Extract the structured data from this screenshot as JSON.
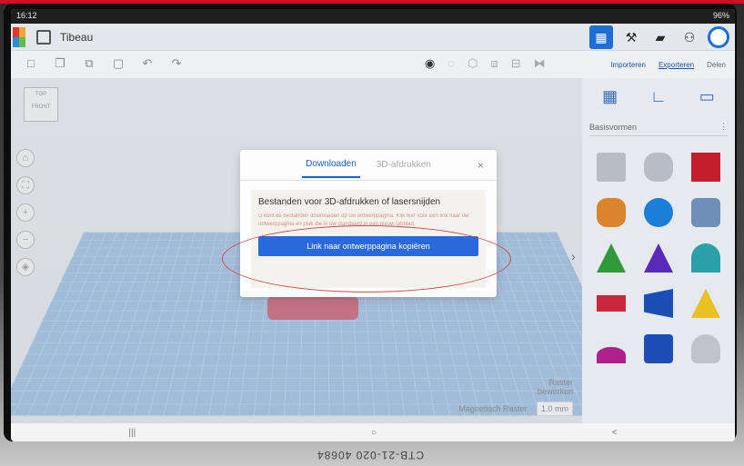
{
  "status": {
    "time": "16:12",
    "battery": "96%"
  },
  "app": {
    "title": "Tibeau"
  },
  "tabs": {
    "importeren": "Importeren",
    "exporteren": "Exporteren",
    "delen": "Delen"
  },
  "viewcube": {
    "top": "TOP",
    "front": "FRONT"
  },
  "panel": {
    "dropdown": "Basisvormen"
  },
  "raster": {
    "bewerken_line1": "Raster",
    "bewerken_line2": "bewerken",
    "magnetisch": "Magnetisch Raster",
    "value": "1.0 mm"
  },
  "modal": {
    "tab_downloaden": "Downloaden",
    "tab_3d": "3D-afdrukken",
    "close": "×",
    "heading": "Bestanden voor 3D-afdrukken of lasersnijden",
    "body": "U kunt de bestanden downloaden op uw ontwerppagina. Klik hier voor een link naar uw ontwerppagina en plak die in uw standaard in een nieuw tabblad.",
    "button": "Link naar ontwerppagina kopiëren"
  },
  "navbar": {
    "recent": "|||",
    "home": "○",
    "back": "<"
  },
  "sticker": "CTB-21-020 40684",
  "colors": {
    "accent": "#2a68dd",
    "annotation": "#d04a44"
  }
}
